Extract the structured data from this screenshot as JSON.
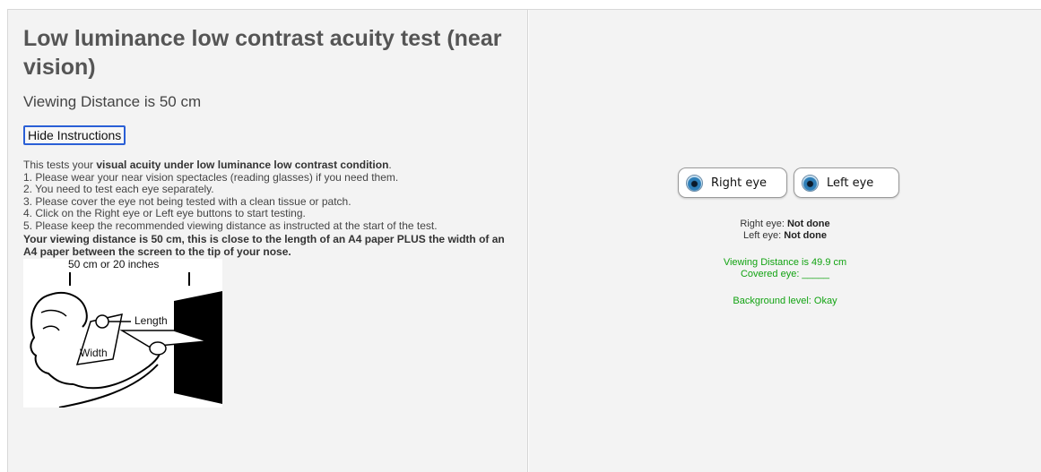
{
  "left": {
    "title": "Low luminance low contrast acuity test (near vision)",
    "viewing_distance": "Viewing Distance is 50 cm",
    "hide_button": "Hide Instructions",
    "intro_prefix": "This tests your ",
    "intro_bold": "visual acuity under low luminance low contrast condition",
    "intro_suffix": ".",
    "steps": [
      "1. Please wear your near vision spectacles (reading glasses) if you need them.",
      "2. You need to test each eye separately.",
      "3. Please cover the eye not being tested with a clean tissue or patch.",
      "4. Click on the Right eye or Left eye buttons to start testing.",
      "5. Please keep the recommended viewing distance as instructed at the start of the test."
    ],
    "distance_note": "Your viewing distance is 50 cm, this is close to the length of an A4 paper PLUS the width of an A4 paper between the screen to the tip of your nose.",
    "diagram": {
      "distance_label": "50 cm or 20 inches",
      "length_label": "Length",
      "width_label": "Width"
    }
  },
  "right": {
    "right_eye_button": "Right eye",
    "left_eye_button": "Left eye",
    "right_eye_status_label": "Right eye:",
    "right_eye_status_value": "Not done",
    "left_eye_status_label": "Left eye:",
    "left_eye_status_value": "Not done",
    "measured_distance": "Viewing Distance is 49.9 cm",
    "covered_eye": "Covered eye: _____",
    "background_level": "Background level: Okay"
  },
  "colors": {
    "panel_bg": "#f3f3f3",
    "status_green": "#12a312",
    "button_focus_border": "#2a5fd6"
  }
}
